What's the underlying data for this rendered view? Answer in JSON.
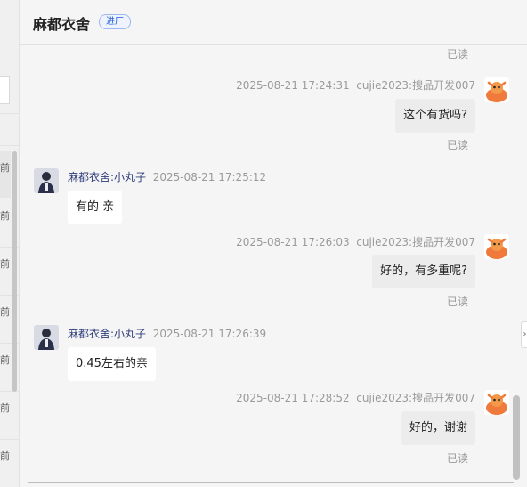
{
  "header": {
    "shop_name": "麻都衣舍",
    "badge": "进厂"
  },
  "left_panel": {
    "time_suffix": "前"
  },
  "read_label": "已读",
  "messages": [
    {
      "direction": "out",
      "sender": "cujie2023:搜品开发007",
      "time": "2025-08-21 17:24:31",
      "text": "这个有货吗?",
      "status": "已读"
    },
    {
      "direction": "in",
      "sender": "麻都衣舍:小丸子",
      "time": "2025-08-21 17:25:12",
      "text": "有的 亲"
    },
    {
      "direction": "out",
      "sender": "cujie2023:搜品开发007",
      "time": "2025-08-21 17:26:03",
      "text": "好的，有多重呢?",
      "status": "已读"
    },
    {
      "direction": "in",
      "sender": "麻都衣舍:小丸子",
      "time": "2025-08-21 17:26:39",
      "text": "0.45左右的亲"
    },
    {
      "direction": "out",
      "sender": "cujie2023:搜品开发007",
      "time": "2025-08-21 17:28:52",
      "text": "好的，谢谢",
      "status": "已读"
    }
  ],
  "icons": {
    "self_avatar": "cartoon-monster-avatar",
    "shop_avatar": "person-photo-avatar",
    "expand": "chevron-right-icon"
  },
  "colors": {
    "sender_name": "#2f3e7a",
    "badge_text": "#1f5cd6",
    "self_avatar": "#f07a3c"
  }
}
